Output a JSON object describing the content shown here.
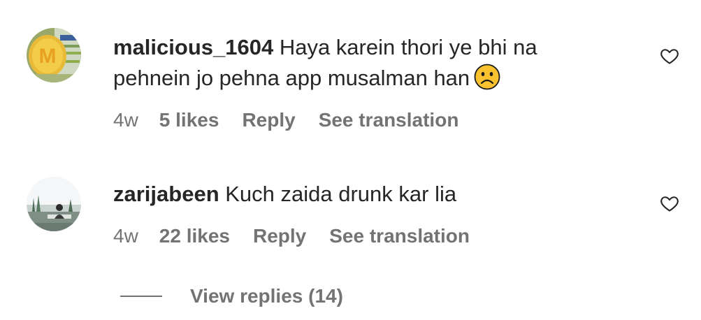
{
  "comments": [
    {
      "username": "malicious_1604",
      "text": "Haya karein thori ye bhi na pehnein jo pehna app musalman han",
      "emoji": "frowning-face",
      "time": "4w",
      "likes": "5 likes",
      "reply_label": "Reply",
      "translation_label": "See translation",
      "avatar_letter": "M"
    },
    {
      "username": "zarijabeen",
      "text": "Kuch zaida drunk kar lia",
      "time": "4w",
      "likes": "22 likes",
      "reply_label": "Reply",
      "translation_label": "See translation"
    }
  ],
  "view_replies_label": "View replies (14)",
  "colors": {
    "primary_text": "#262626",
    "secondary_text": "#737373",
    "emoji_yellow": "#F9C22E"
  }
}
